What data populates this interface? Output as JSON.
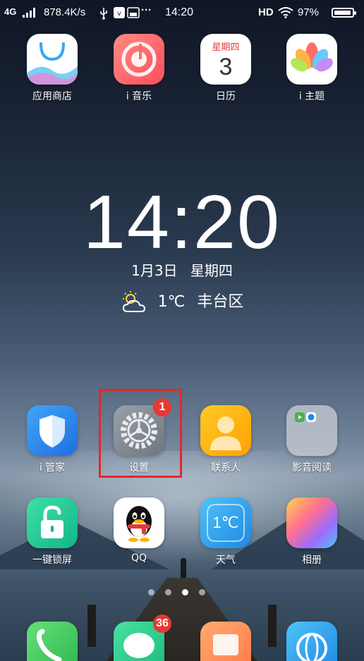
{
  "status_bar": {
    "network": "4G",
    "speed": "878.4K/s",
    "more": "···",
    "time": "14:20",
    "hd": "HD",
    "battery": "97%",
    "battery_level": 0.97,
    "icons": [
      "signal-icon",
      "usb-icon",
      "notification-app-icon",
      "wifi-icon",
      "battery-icon"
    ]
  },
  "top_row": [
    {
      "label": "应用商店",
      "icon": "app-store-icon"
    },
    {
      "label": "i 音乐",
      "icon": "music-icon"
    },
    {
      "label": "日历",
      "icon": "calendar-icon",
      "calendar_weekday": "星期四",
      "calendar_day": "3"
    },
    {
      "label": "i 主题",
      "icon": "theme-icon"
    }
  ],
  "clock_widget": {
    "time": "14:20",
    "date": "1月3日",
    "weekday": "星期四",
    "temperature": "1℃",
    "location": "丰台区",
    "weather_icon": "partly-cloudy-icon"
  },
  "middle_row": [
    {
      "label": "i 管家",
      "icon": "shield-icon"
    },
    {
      "label": "设置",
      "icon": "gear-icon",
      "badge": "1"
    },
    {
      "label": "联系人",
      "icon": "contacts-icon"
    },
    {
      "label": "影音阅读",
      "icon": "folder-icon"
    }
  ],
  "lower_row": [
    {
      "label": "一键锁屏",
      "icon": "lock-icon"
    },
    {
      "label": "QQ",
      "icon": "qq-penguin-icon"
    },
    {
      "label": "天气",
      "icon": "weather-icon",
      "text": "1℃"
    },
    {
      "label": "相册",
      "icon": "gallery-icon"
    }
  ],
  "dock": [
    {
      "icon": "phone-icon"
    },
    {
      "icon": "messages-icon",
      "badge": "36"
    },
    {
      "icon": "files-icon"
    },
    {
      "icon": "browser-icon"
    }
  ],
  "page_indicator": {
    "pages": 4,
    "active": 3
  },
  "colors": {
    "badge": "#e53935",
    "highlight": "#e5262a"
  }
}
